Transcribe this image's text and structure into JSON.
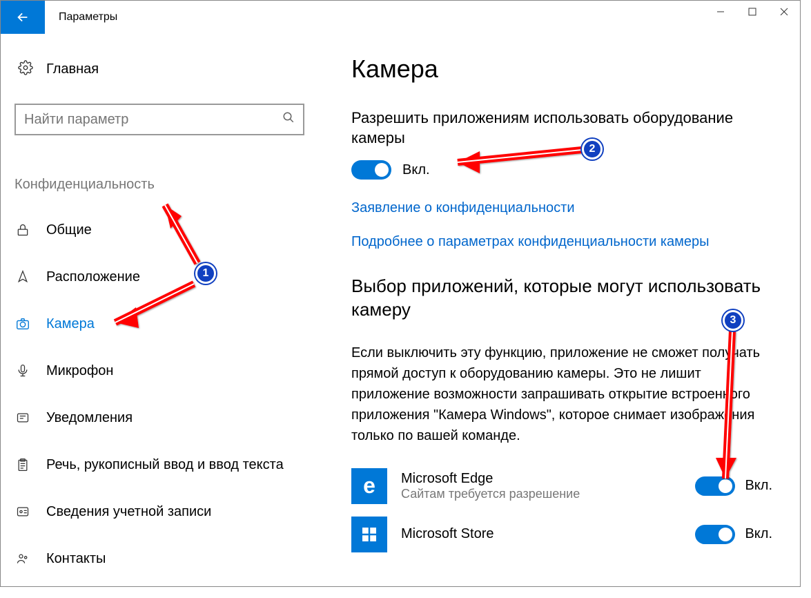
{
  "window": {
    "title": "Параметры"
  },
  "sidebar": {
    "home": "Главная",
    "search_placeholder": "Найти параметр",
    "section": "Конфиденциальность",
    "items": [
      {
        "label": "Общие",
        "icon": "lock"
      },
      {
        "label": "Расположение",
        "icon": "location"
      },
      {
        "label": "Камера",
        "icon": "camera",
        "active": true
      },
      {
        "label": "Микрофон",
        "icon": "microphone"
      },
      {
        "label": "Уведомления",
        "icon": "notification"
      },
      {
        "label": "Речь, рукописный ввод и ввод текста",
        "icon": "clipboard"
      },
      {
        "label": "Сведения учетной записи",
        "icon": "account"
      },
      {
        "label": "Контакты",
        "icon": "contacts"
      }
    ]
  },
  "main": {
    "title": "Камера",
    "allow_heading": "Разрешить приложениям использовать оборудование камеры",
    "toggle_state": "Вкл.",
    "link_privacy": "Заявление о конфиденциальности",
    "link_learn": "Подробнее о параметрах конфиденциальности камеры",
    "choose_heading": "Выбор приложений, которые могут использовать камеру",
    "choose_body": "Если выключить эту функцию, приложение не сможет получать прямой доступ к оборудованию камеры. Это не лишит приложение возможности запрашивать открытие встроенного приложения \"Камера Windows\", которое снимает изображения только по вашей команде.",
    "apps": [
      {
        "name": "Microsoft Edge",
        "sub": "Сайтам требуется разрешение",
        "state": "Вкл.",
        "icon": "e"
      },
      {
        "name": "Microsoft Store",
        "sub": "",
        "state": "Вкл.",
        "icon": "store"
      }
    ]
  },
  "annotations": {
    "b1": "1",
    "b2": "2",
    "b3": "3"
  }
}
